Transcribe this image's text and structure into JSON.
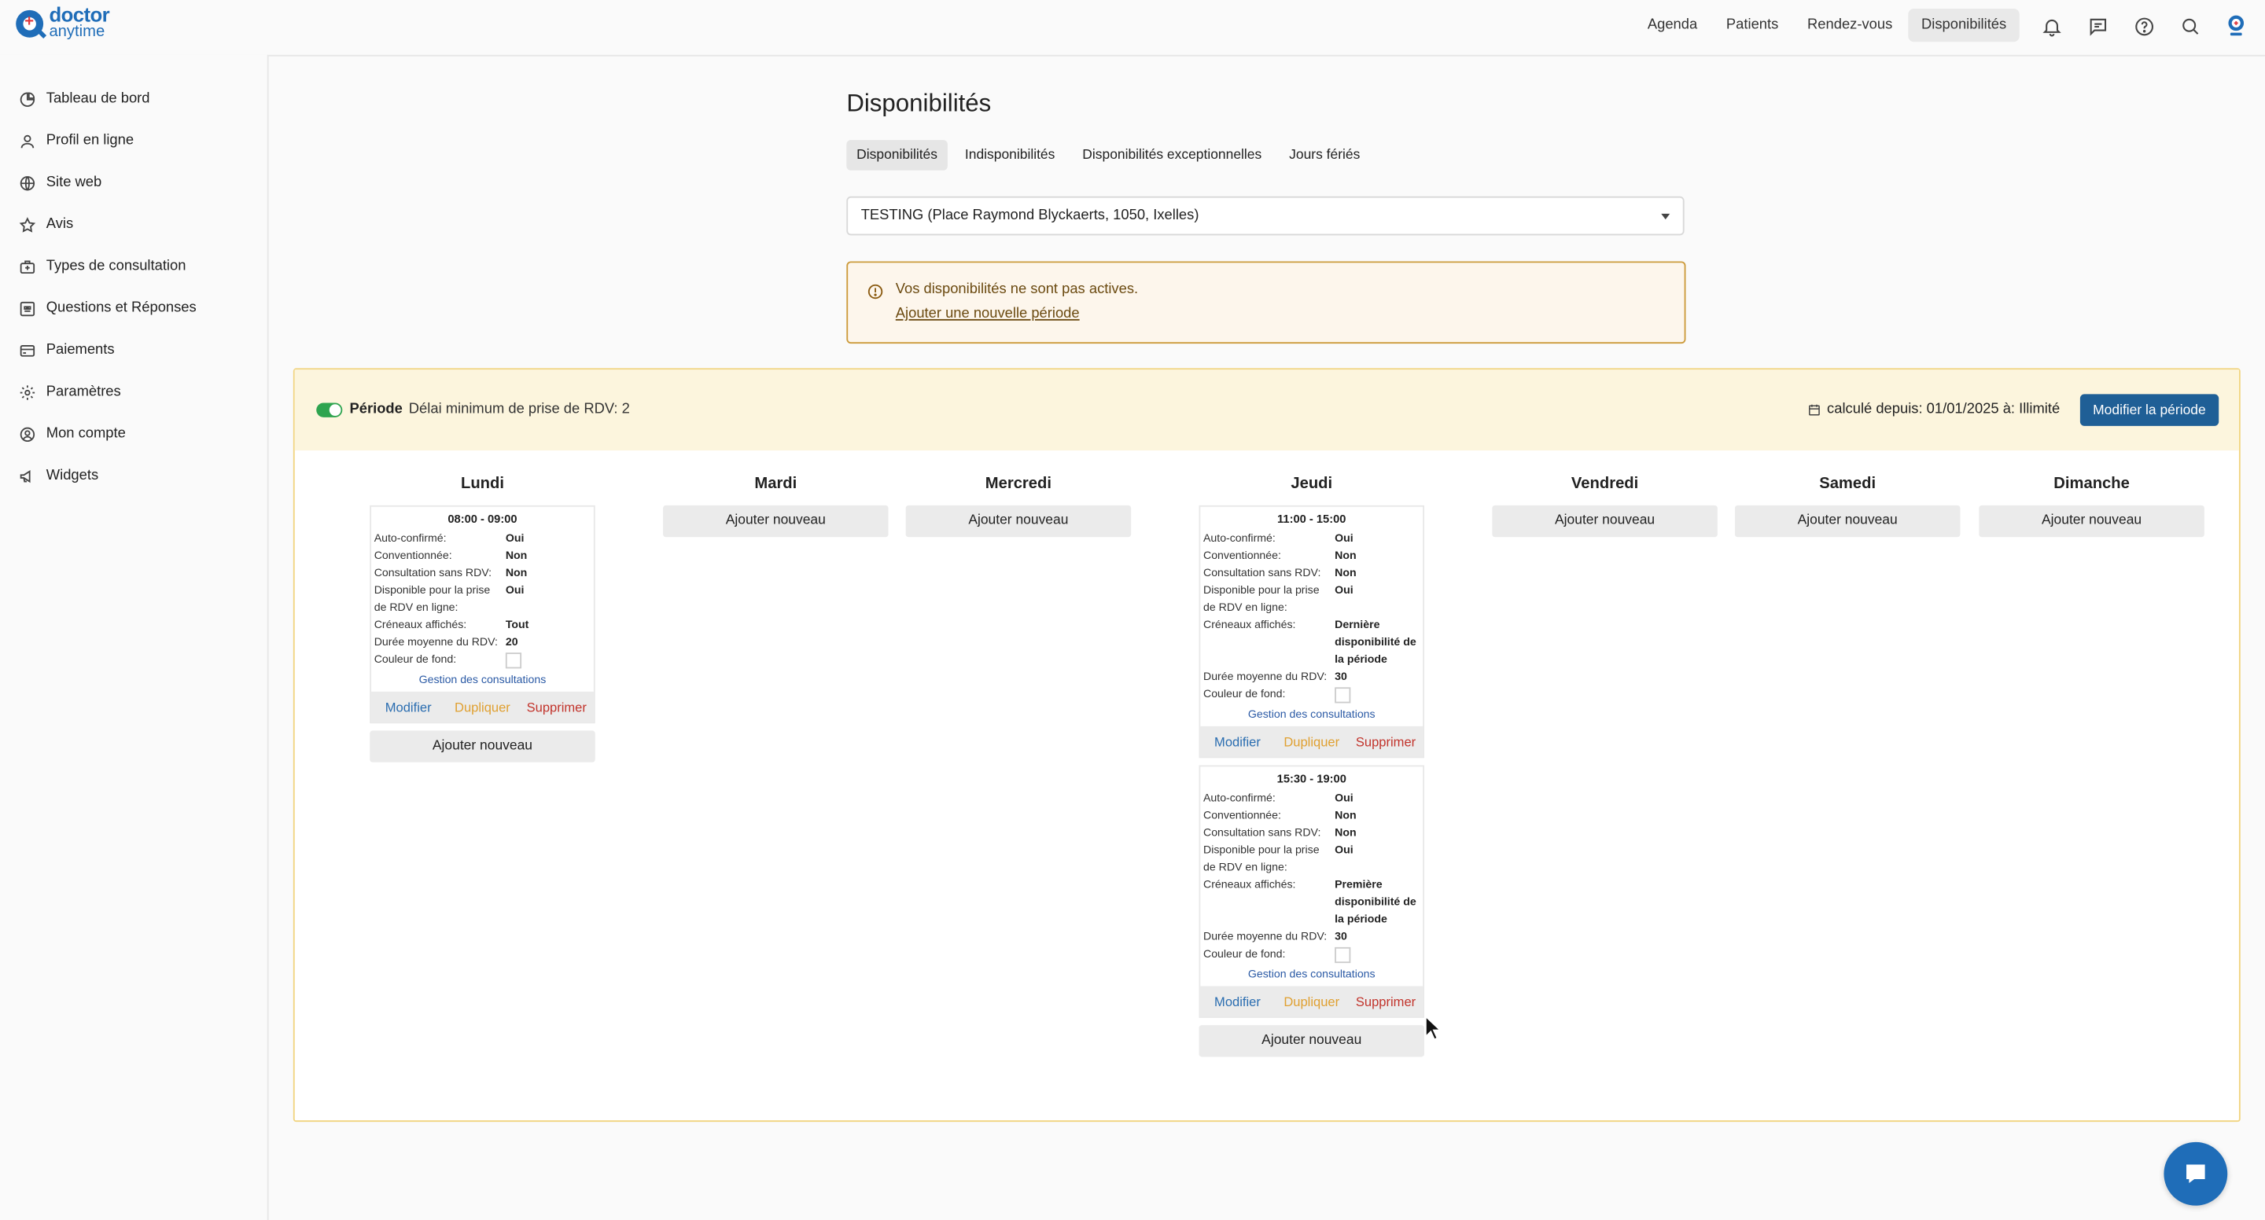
{
  "logo": {
    "line1": "doctor",
    "line2": "anytime"
  },
  "topnav": {
    "items": [
      "Agenda",
      "Patients",
      "Rendez-vous",
      "Disponibilités"
    ],
    "active": "Disponibilités",
    "icons": [
      "bell-icon",
      "message-icon",
      "help-icon",
      "search-icon",
      "avatar-icon"
    ]
  },
  "sidebar": {
    "items": [
      {
        "label": "Tableau de bord",
        "icon": "dashboard-icon"
      },
      {
        "label": "Profil en ligne",
        "icon": "user-icon"
      },
      {
        "label": "Site web",
        "icon": "globe-icon"
      },
      {
        "label": "Avis",
        "icon": "star-icon"
      },
      {
        "label": "Types de consultation",
        "icon": "medical-bag-icon"
      },
      {
        "label": "Questions et Réponses",
        "icon": "qa-icon"
      },
      {
        "label": "Paiements",
        "icon": "card-icon"
      },
      {
        "label": "Paramètres",
        "icon": "gear-icon"
      },
      {
        "label": "Mon compte",
        "icon": "account-icon"
      },
      {
        "label": "Widgets",
        "icon": "megaphone-icon"
      }
    ]
  },
  "page": {
    "title": "Disponibilités",
    "tabs": [
      "Disponibilités",
      "Indisponibilités",
      "Disponibilités exceptionnelles",
      "Jours fériés"
    ],
    "location_select": "TESTING (Place Raymond Blyckaerts, 1050, Ixelles)",
    "alert": {
      "text": "Vos disponibilités ne sont pas actives.",
      "link": "Ajouter une nouvelle période"
    }
  },
  "period": {
    "label": "Période",
    "delay": "Délai minimum de prise de RDV: 2",
    "calc": "calculé depuis: 01/01/2025 à: Illimité",
    "edit_button": "Modifier la période",
    "add_label": "Ajouter nouveau",
    "manage_label": "Gestion des consultations",
    "actions": {
      "edit": "Modifier",
      "duplicate": "Dupliquer",
      "delete": "Supprimer"
    },
    "field_labels": {
      "auto": "Auto-confirmé:",
      "conv": "Conventionnée:",
      "sans": "Consultation sans RDV:",
      "dispo": "Disponible pour la prise de RDV en ligne:",
      "cren": "Créneaux affichés:",
      "duree": "Durée moyenne du RDV:",
      "color": "Couleur de fond:"
    },
    "days": [
      {
        "name": "Lundi",
        "slots": [
          {
            "time": "08:00 - 09:00",
            "auto": "Oui",
            "conv": "Non",
            "sans": "Non",
            "dispo": "Oui",
            "cren": "Tout",
            "duree": "20"
          }
        ]
      },
      {
        "name": "Mardi",
        "slots": []
      },
      {
        "name": "Mercredi",
        "slots": []
      },
      {
        "name": "Jeudi",
        "slots": [
          {
            "time": "11:00 - 15:00",
            "auto": "Oui",
            "conv": "Non",
            "sans": "Non",
            "dispo": "Oui",
            "cren": "Dernière disponibilité de la période",
            "duree": "30"
          },
          {
            "time": "15:30 - 19:00",
            "auto": "Oui",
            "conv": "Non",
            "sans": "Non",
            "dispo": "Oui",
            "cren": "Première disponibilité de la période",
            "duree": "30"
          }
        ]
      },
      {
        "name": "Vendredi",
        "slots": []
      },
      {
        "name": "Samedi",
        "slots": []
      },
      {
        "name": "Dimanche",
        "slots": []
      }
    ]
  },
  "colors": {
    "primary": "#1f5f96",
    "accent": "#1f6db8",
    "toggle_on": "#2ea44f",
    "warning_border": "#cc9a3a",
    "period_bg": "#fcf5dd"
  }
}
